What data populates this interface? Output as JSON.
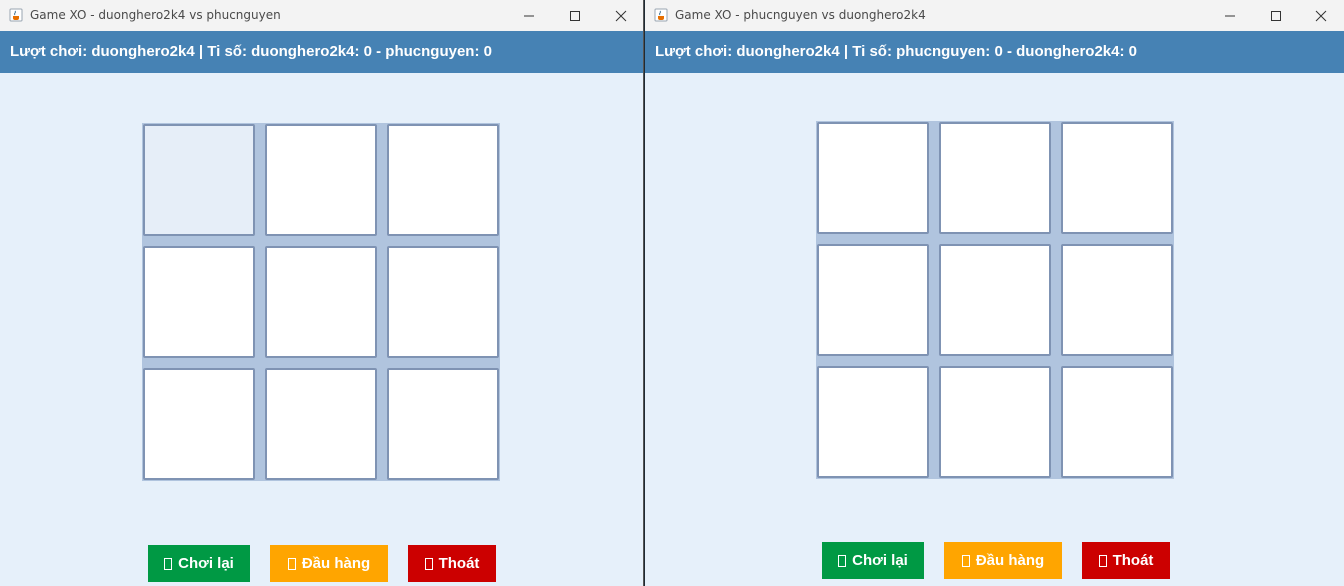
{
  "windows": [
    {
      "title": "Game XO - duonghero2k4 vs phucnguyen",
      "status": "Lượt chơi: duonghero2k4 | Ti số: duonghero2k4: 0 - phucnguyen: 0",
      "cells": [
        "",
        "",
        "",
        "",
        "",
        "",
        "",
        "",
        ""
      ],
      "buttons": {
        "replay": "Chơi lại",
        "surrender": "Đầu hàng",
        "exit": "Thoát"
      }
    },
    {
      "title": "Game XO - phucnguyen vs duonghero2k4",
      "status": "Lượt chơi: duonghero2k4 | Ti số: phucnguyen: 0 - duonghero2k4: 0",
      "cells": [
        "",
        "",
        "",
        "",
        "",
        "",
        "",
        "",
        ""
      ],
      "buttons": {
        "replay": "Chơi lại",
        "surrender": "Đầu hàng",
        "exit": "Thoát"
      }
    }
  ],
  "colors": {
    "status_bar": "#4682b4",
    "replay_button": "#009944",
    "surrender_button": "#ffa500",
    "exit_button": "#cc0000",
    "board_background": "#b0c4de",
    "window_background": "#e6f0fa"
  },
  "icons": {
    "app": "java-coffee-icon",
    "minimize": "minimize-icon",
    "maximize": "maximize-icon",
    "close": "close-icon"
  }
}
